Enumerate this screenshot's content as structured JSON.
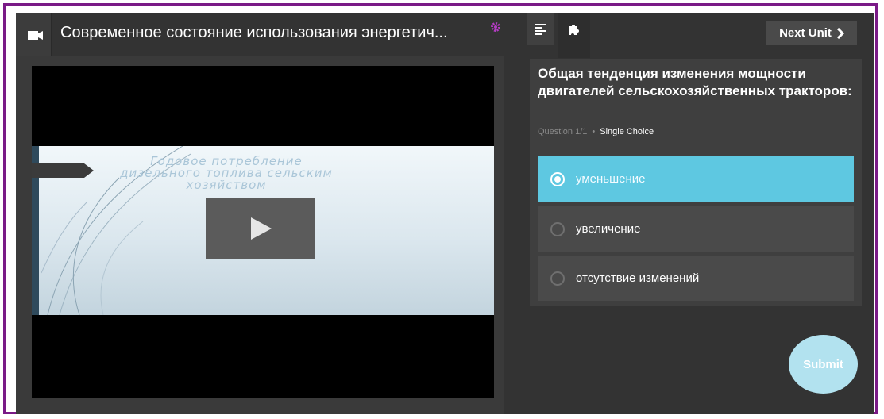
{
  "header": {
    "video_icon": "video-camera-icon",
    "title": "Современное состояние использования энергетич...",
    "gear_icon": "gear-icon",
    "list_icon": "list-icon",
    "puzzle_icon": "puzzle-icon",
    "next_label": "Next Unit",
    "next_icon": "chevron-right-icon"
  },
  "video": {
    "slide_title": "Годовое потребление дизельного топлива сельским хозяйством",
    "play_icon": "play-icon"
  },
  "quiz": {
    "question": "Общая тенденция изменения мощности двигателей сельскохозяйственных тракторов:",
    "progress": "Question 1/1",
    "separator": "•",
    "type": "Single Choice",
    "options": [
      {
        "label": "уменьшение",
        "selected": true
      },
      {
        "label": "увеличение",
        "selected": false
      },
      {
        "label": "отсутствие изменений",
        "selected": false
      }
    ],
    "submit_label": "Submit"
  },
  "colors": {
    "frame_border": "#7a1a87",
    "background": "#333333",
    "selected_option": "#5ec8e1",
    "submit": "#b2e2ef",
    "gear": "#b53cc4"
  }
}
